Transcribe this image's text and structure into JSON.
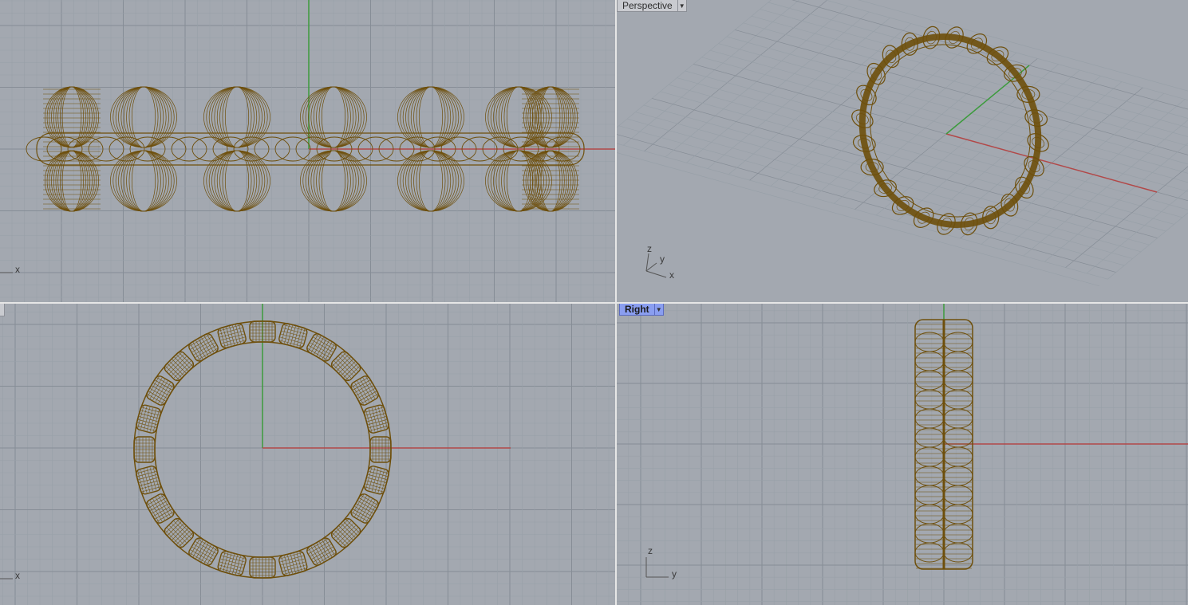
{
  "viewports": {
    "front": {
      "axes": {
        "x": "x"
      }
    },
    "perspective": {
      "label": "Perspective",
      "axes": {
        "z": "z",
        "y": "y",
        "x": "x"
      }
    },
    "top": {
      "axes": {
        "x": "x"
      }
    },
    "right": {
      "label": "Right",
      "axes": {
        "z": "z",
        "y": "y"
      }
    }
  },
  "icons": {
    "dropdown": "chevron-down-icon"
  },
  "colors": {
    "viewport_bg": "#a3a8b0",
    "grid_minor": "#98a0a8",
    "grid_major": "#868d96",
    "x_axis": "#b24848",
    "y_axis": "#3c9b3c",
    "wire": "#6e4f0b",
    "active_label": "#8a9ef0"
  }
}
